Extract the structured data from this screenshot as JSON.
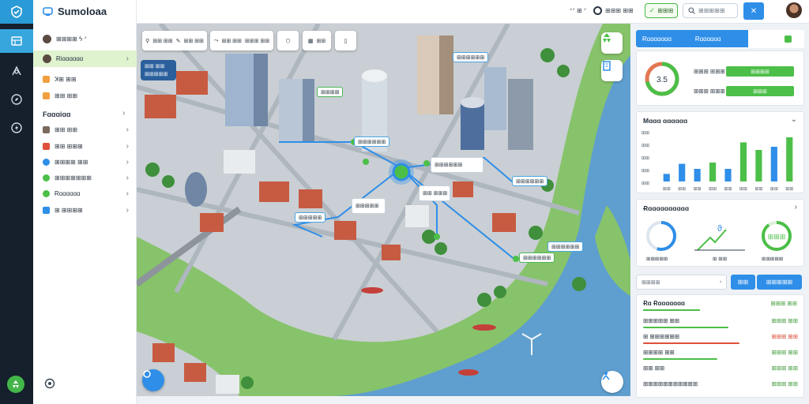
{
  "app": {
    "title": "Sumoloaa"
  },
  "colors": {
    "accent_blue": "#2f8ee8",
    "accent_green": "#4cbf48",
    "rail_bg": "#16202c",
    "water": "#5f9fcf"
  },
  "rail": {
    "icons": [
      "shield-check-icon",
      "layers-icon",
      "route-icon",
      "compass-icon",
      "bolt-icon"
    ],
    "bottom": [
      "recycle-icon",
      "settings-icon"
    ]
  },
  "sidebar": {
    "top_items": [
      {
        "label": "⊞⊞⊞⊞ ϟ ᐟ",
        "icon": "user-avatar"
      },
      {
        "label": "Ɍiɑɑɑɑɑɑ",
        "icon": "user-avatar"
      },
      {
        "label": "ꓘ⊞ ⊞⊞",
        "icon": "orange-square-icon"
      },
      {
        "label": "⊞⊞ ⊞⊞",
        "icon": "orange-square-icon"
      }
    ],
    "section": "Fɑɑɑiɑɑ",
    "section_items": [
      {
        "label": "⊞⊞ ⊞⊞",
        "color": "#7a6a5d"
      },
      {
        "label": "⊞⊞ ⊞⊞⊞",
        "color": "#e0503a"
      },
      {
        "label": "⊞⊞⊞⊞ ⊞⊞",
        "color": "#2f8ee8"
      },
      {
        "label": "⊞⊞⊞⊞⊞⊞⊞",
        "color": "#4cbf48"
      },
      {
        "label": "Ɍɑɑɑɑɑɑ",
        "color": "#4cbf48"
      },
      {
        "label": "⊞ ⊞⊞⊞⊞",
        "color": "#2f8ee8"
      }
    ]
  },
  "header": {
    "text_a": "ᐟᐟ ⊞ ᐟ",
    "text_b": "⊞⊞⊞ ⊞⊞",
    "green_button": "⊞⊞⊞",
    "search_placeholder": "⊞⊞⊞⊞⊞",
    "close_label": "✕"
  },
  "map": {
    "toolbar": [
      "⊞⊞ ⊞⊞",
      "⊞⊞ ⊞⊞",
      "⊞⊞ ⊞⊞",
      "⊞⊞⊞ ⊞⊞",
      "",
      "⊞⊞",
      ""
    ],
    "legend": {
      "line1": "⊞⊞ ⊞⊞",
      "line2": "⊞⊞⊞⊞⊞"
    },
    "labels": [
      {
        "text": "⊞⊞⊞⊞⊞⊞",
        "style": "blue"
      },
      {
        "text": "⊞⊞⊞⊞",
        "style": "green"
      },
      {
        "text": "⊞⊞⊞⊞⊞⊞",
        "style": "blue"
      },
      {
        "text": "⊞⊞⊞⊞⊞⊞",
        "style": "big"
      },
      {
        "text": "⊞⊞ ⊞⊞⊞",
        "style": "big"
      },
      {
        "text": "⊞⊞⊞⊞⊞⊞",
        "style": "blue"
      },
      {
        "text": "⊞⊞⊞⊞⊞",
        "style": "big"
      },
      {
        "text": "⊞⊞⊞⊞⊞",
        "style": "blue"
      },
      {
        "text": "⊞⊞⊞⊞⊞⊞",
        "style": "blue"
      },
      {
        "text": "⊞⊞⊞⊞⊞⊞",
        "style": "green"
      }
    ]
  },
  "right": {
    "tabs": {
      "tab1a": "Ɍɑɑɑɑɑɑɑ",
      "tab1b": "Ɍɑɑɑɑɑɑ"
    },
    "summary": {
      "center": "3.5",
      "ring_fraction": 0.72,
      "rows": [
        {
          "key": "⊞⊞⊞ ⊞⊞⊞",
          "value": "⊞⊞⊞⊞"
        },
        {
          "key": "⊞⊞⊞ ⊞⊞⊞",
          "value": "⊞⊞⊞"
        }
      ]
    },
    "chart_title": "Mɑɑɑ ɑɑɑɑɑɑ",
    "chart_yticks": [
      "⊞⊞",
      "⊞⊞",
      "⊞⊞",
      "⊞⊞",
      "⊞⊞"
    ],
    "chart_xticks": [
      "⊞⊞",
      "⊞⊞",
      "⊞⊞",
      "⊞⊞",
      "⊞⊞",
      "⊞⊞",
      "⊞⊞",
      "⊞⊞",
      "⊞⊞"
    ],
    "gauges_title": "Ɍɑɑɑɑɑɑɑɑɑɑ",
    "gauges": [
      {
        "label": "⊞⊞⊞⊞⊞",
        "center": "",
        "fraction": 0.55,
        "color": "#2f8ee8"
      },
      {
        "label": "⊞ ⊞⊞",
        "center": "ϑ",
        "fraction": 0,
        "color": "#4cbf48"
      },
      {
        "label": "⊞⊞⊞⊞⊞",
        "center": "⊞⊞⊞",
        "fraction": 0.9,
        "color": "#4cbf48"
      }
    ],
    "filter": {
      "placeholder": "⊞⊞⊞⊞",
      "btn1": "⊞⊞",
      "btn2": "⊞⊞⊞⊞⊞"
    },
    "list_title": "Ɍɑ Ɍɑɑɑɑɑɑɑ",
    "list_title_value": "⊞⊞⊞ ⊞⊞",
    "list": [
      {
        "name": "⊞⊞⊞⊞⊞ ⊞⊞",
        "value": "⊞⊞⊞ ⊞⊞",
        "bar": 0.55,
        "bar_color": "#4cbf48"
      },
      {
        "name": "⊞ ⊞⊞⊞⊞⊞⊞",
        "value": "⊞⊞⊞ ⊞⊞",
        "bar": 0.62,
        "bar_color": "#e0503a"
      },
      {
        "name": "⊞⊞⊞⊞ ⊞⊞",
        "value": "⊞⊞⊞ ⊞⊞",
        "bar": 0.48,
        "bar_color": "#4cbf48"
      },
      {
        "name": "⊞⊞ ⊞⊞",
        "value": "⊞⊞⊞ ⊞⊞",
        "bar": 0,
        "bar_color": "#4cbf48"
      },
      {
        "name": "⊞⊞⊞⊞⊞⊞⊞⊞⊞⊞⊞",
        "value": "⊞⊞⊞ ⊞⊞",
        "bar": 0,
        "bar_color": "#4cbf48"
      }
    ]
  },
  "chart_data": {
    "type": "bar",
    "title": "Mɑɑɑ ɑɑɑɑɑɑ",
    "categories": [
      "1",
      "2",
      "3",
      "4",
      "5",
      "6",
      "7",
      "8",
      "9"
    ],
    "series": [
      {
        "values": [
          1.2,
          2.8,
          2.0,
          3.0,
          2.0,
          6.2,
          5.0,
          5.5,
          7.0
        ]
      }
    ],
    "colors": [
      "#2f8ee8",
      "#2f8ee8",
      "#2f8ee8",
      "#4cbf48",
      "#2f8ee8",
      "#4cbf48",
      "#4cbf48",
      "#2f8ee8",
      "#4cbf48"
    ],
    "ylim": [
      0,
      8
    ],
    "grid": false
  }
}
